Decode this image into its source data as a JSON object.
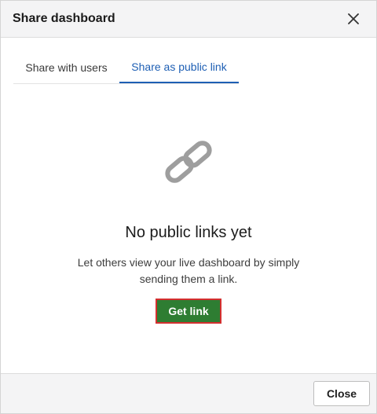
{
  "dialog": {
    "title": "Share dashboard",
    "close_icon": "close-icon"
  },
  "tabs": [
    {
      "label": "Share with users",
      "active": false
    },
    {
      "label": "Share as public link",
      "active": true
    }
  ],
  "empty_state": {
    "icon": "link-icon",
    "title": "No public links yet",
    "description": "Let others view your live dashboard by simply sending them a link.",
    "button_label": "Get link"
  },
  "footer": {
    "close_label": "Close"
  },
  "colors": {
    "accent": "#1e5fb4",
    "primary_button": "#2e7d32",
    "highlight_border": "#d32f2f",
    "icon_gray": "#9e9e9e"
  }
}
